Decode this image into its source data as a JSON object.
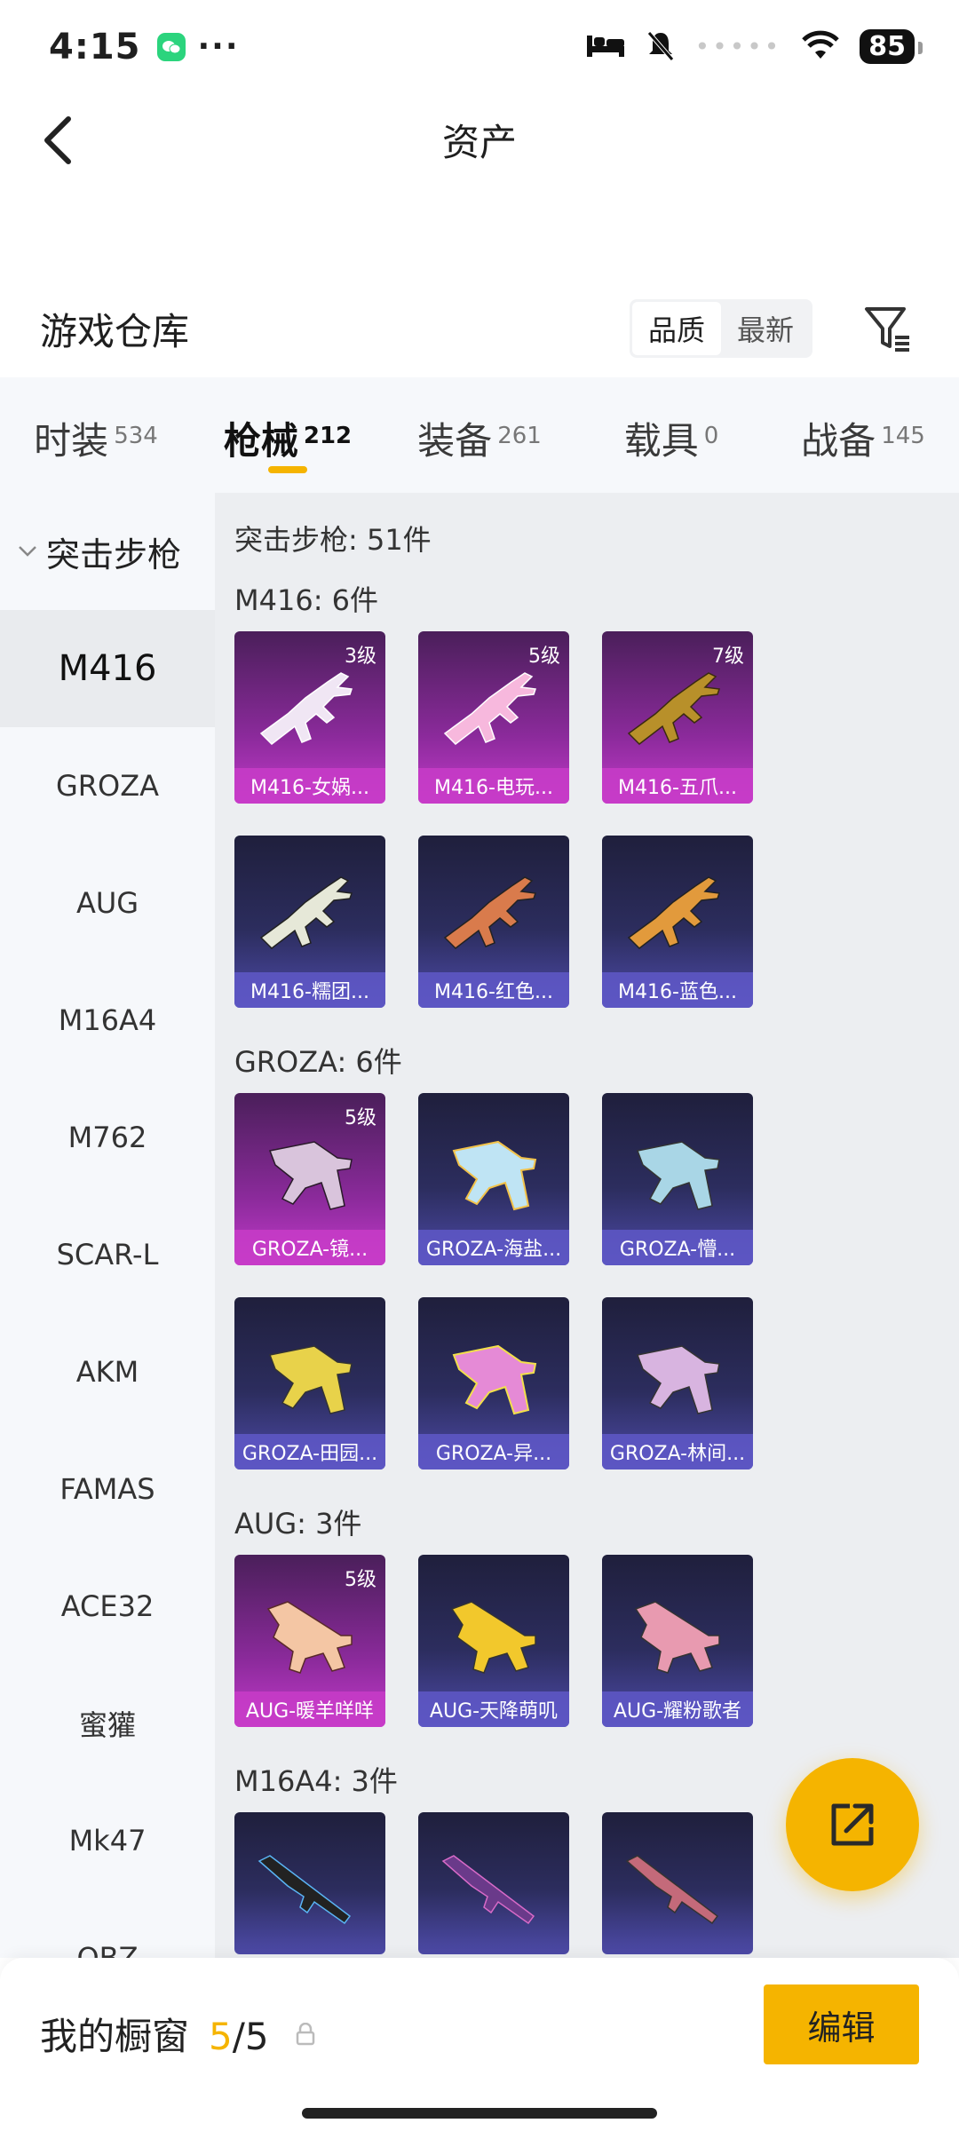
{
  "status": {
    "time": "4:15",
    "battery": "85"
  },
  "header": {
    "title": "资产"
  },
  "warehouse": {
    "title": "游戏仓库",
    "sort_options": [
      "品质",
      "最新"
    ]
  },
  "tabs": [
    {
      "label": "时装",
      "count": "534"
    },
    {
      "label": "枪械",
      "count": "212"
    },
    {
      "label": "装备",
      "count": "261"
    },
    {
      "label": "载具",
      "count": "0"
    },
    {
      "label": "战备",
      "count": "145"
    }
  ],
  "sidebar": {
    "group_label": "突击步枪",
    "items": [
      "M416",
      "GROZA",
      "AUG",
      "M16A4",
      "M762",
      "SCAR-L",
      "AKM",
      "FAMAS",
      "ACE32",
      "蜜獾",
      "Mk47",
      "QBZ"
    ]
  },
  "content": {
    "summary": "突击步枪: 51件",
    "sections": [
      {
        "title": "M416: 6件",
        "cards": [
          {
            "label": "M416-女娲...",
            "level": "3级"
          },
          {
            "label": "M416-电玩...",
            "level": "5级"
          },
          {
            "label": "M416-五爪...",
            "level": "7级"
          },
          {
            "label": "M416-糯团...",
            "level": ""
          },
          {
            "label": "M416-红色...",
            "level": ""
          },
          {
            "label": "M416-蓝色...",
            "level": ""
          }
        ]
      },
      {
        "title": "GROZA: 6件",
        "cards": [
          {
            "label": "GROZA-镜...",
            "level": "5级"
          },
          {
            "label": "GROZA-海盐...",
            "level": ""
          },
          {
            "label": "GROZA-懵...",
            "level": ""
          },
          {
            "label": "GROZA-田园...",
            "level": ""
          },
          {
            "label": "GROZA-异...",
            "level": ""
          },
          {
            "label": "GROZA-林间...",
            "level": ""
          }
        ]
      },
      {
        "title": "AUG: 3件",
        "cards": [
          {
            "label": "AUG-暖羊咩咩",
            "level": "5级"
          },
          {
            "label": "AUG-天降萌叽",
            "level": ""
          },
          {
            "label": "AUG-耀粉歌者",
            "level": ""
          }
        ]
      },
      {
        "title": "M16A4: 3件",
        "cards": [
          {
            "label": "",
            "level": ""
          },
          {
            "label": "",
            "level": ""
          },
          {
            "label": "",
            "level": ""
          }
        ]
      }
    ]
  },
  "showcase": {
    "label": "我的橱窗",
    "count": "5",
    "total": "/5"
  },
  "edit_button": "编辑",
  "colors": {
    "accent": "#f5b400",
    "purple_card": "#c13ac9",
    "blue_card": "#4d4aa8"
  }
}
